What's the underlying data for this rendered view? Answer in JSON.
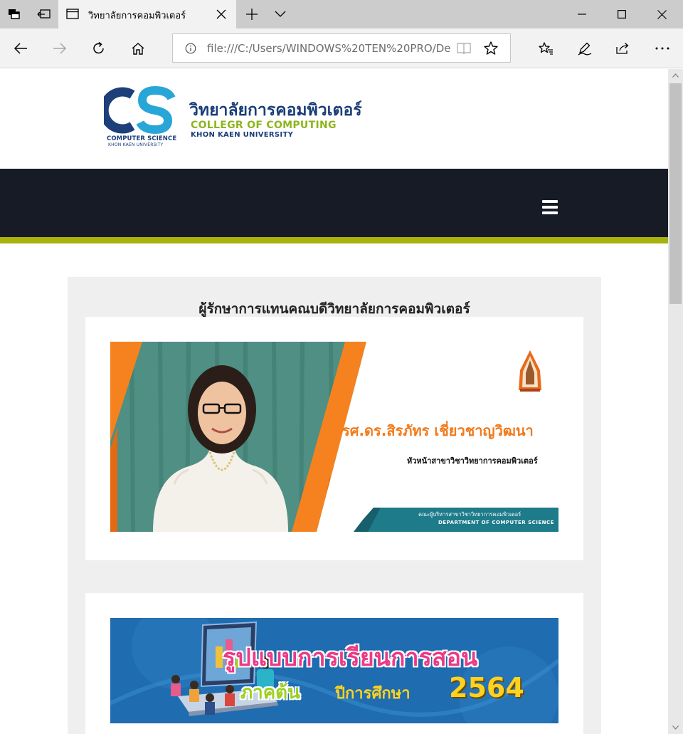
{
  "browser": {
    "tab_title": "วิทยาลัยการคอมพิวเตอร์",
    "address": "file:///C:/Users/WINDOWS%20TEN%20PRO/De"
  },
  "site": {
    "logo_mark": "CS",
    "logo_sub1": "COMPUTER SCIENCE",
    "logo_sub2": "KHON KAEN UNIVERSITY",
    "name_th": "วิทยาลัยการคอมพิวเตอร์",
    "name_en": "COLLEGR OF COMPUTING",
    "name_en2": "KHON KAEN UNIVERSITY",
    "colors": {
      "menu_band": "#161b26",
      "accent": "#a7b20b",
      "brand_blue": "#1a3e78",
      "brand_green": "#8db51c"
    }
  },
  "main": {
    "heading": "ผู้รักษาการแทนคณบดีวิทยาลัยการคอมพิวเตอร์",
    "banner1": {
      "name": "รศ.ดร.สิรภัทร เชี่ยวชาญวิฒนา",
      "title": "หัวหน้าสาขาวิชาวิทยาการคอมพิวเตอร์",
      "footer_th": "คณะผู้บริหารสาขาวิชาวิทยาการคอมพิวเตอร์",
      "footer_en": "DEPARTMENT OF COMPUTER SCIENCE"
    },
    "banner2": {
      "line1": "รูปแบบการเรียนการสอน",
      "line2": "ภาคต้น",
      "line3": "ปีการศึกษา",
      "year": "2564"
    }
  }
}
